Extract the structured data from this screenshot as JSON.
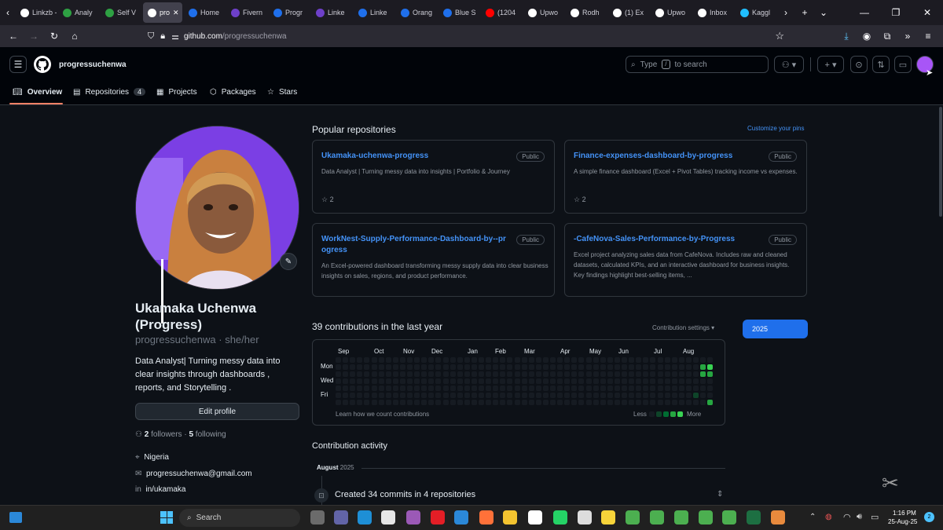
{
  "browser": {
    "tabs": [
      {
        "label": "Linkzb - A",
        "color": "#ffffff"
      },
      {
        "label": "Analy",
        "color": "#2ea043"
      },
      {
        "label": "Self V",
        "color": "#2ea043"
      },
      {
        "label": "pro",
        "color": "#ffffff",
        "active": true
      },
      {
        "label": "Home",
        "color": "#1f6feb"
      },
      {
        "label": "Fivern",
        "color": "#6e40c9"
      },
      {
        "label": "Progr",
        "color": "#1f6feb"
      },
      {
        "label": "Linke",
        "color": "#6e40c9"
      },
      {
        "label": "Linke",
        "color": "#1f6feb"
      },
      {
        "label": "Orang",
        "color": "#1f6feb"
      },
      {
        "label": "Blue S",
        "color": "#1f6feb"
      },
      {
        "label": "(1204",
        "color": "#ff0000"
      },
      {
        "label": "Upwo",
        "color": "#ffffff"
      },
      {
        "label": "Rodh",
        "color": "#ffffff"
      },
      {
        "label": "(1) Ex",
        "color": "#ffffff"
      },
      {
        "label": "Upwo",
        "color": "#ffffff"
      },
      {
        "label": "Inbox",
        "color": "#ffffff"
      },
      {
        "label": "Kaggl",
        "color": "#20beff"
      }
    ],
    "url_host": "github.com",
    "url_path": "/progressuchenwa"
  },
  "github": {
    "username": "progressuchenwa",
    "search_placeholder_pre": "Type",
    "search_key": "/",
    "search_placeholder_post": "to search",
    "nav": {
      "overview": "Overview",
      "repositories": "Repositories",
      "repositories_count": "4",
      "projects": "Projects",
      "packages": "Packages",
      "stars": "Stars"
    }
  },
  "profile": {
    "name_line1": "Ukamaka Uchenwa",
    "name_line2": "(Progress)",
    "login": "progressuchenwa",
    "pronouns": "she/her",
    "bio_lines": [
      "Data Analyst| Turning messy data into",
      "clear insights through dashboards ,",
      "reports, and Storytelling ."
    ],
    "edit_label": "Edit profile",
    "followers_count": "2",
    "followers_label": "followers",
    "following_count": "5",
    "following_label": "following",
    "location": "Nigeria",
    "email": "progressuchenwa@gmail.com",
    "linkedin": "in/ukamaka"
  },
  "popular": {
    "title": "Popular repositories",
    "customize": "Customize your pins",
    "repos": [
      {
        "name": "Ukamaka-uchenwa-progress",
        "badge": "Public",
        "desc": "Data Analyst | Turning messy data into insights | Portfolio & Journey",
        "stars": "2"
      },
      {
        "name": "Finance-expenses-dashboard-by-progress",
        "badge": "Public",
        "desc": "A simple finance dashboard (Excel + Pivot Tables) tracking income vs expenses.",
        "stars": "2"
      },
      {
        "name": "WorkNest-Supply-Performance-Dashboard-by--progress",
        "badge": "Public",
        "desc": "An Excel-powered dashboard transforming messy supply data into clear business insights on sales, regions, and product performance.",
        "stars": ""
      },
      {
        "name": "-CafeNova-Sales-Performance-by-Progress",
        "badge": "Public",
        "desc": "Excel project analyzing sales data from CafeNova. Includes raw and cleaned datasets, calculated KPIs, and an interactive dashboard for business insights. Key findings highlight best-selling items, ...",
        "stars": ""
      }
    ]
  },
  "contributions": {
    "heading": "39 contributions in the last year",
    "settings": "Contribution settings",
    "year": "2025",
    "months": [
      "Sep",
      "Oct",
      "Nov",
      "Dec",
      "Jan",
      "Feb",
      "Mar",
      "Apr",
      "May",
      "Jun",
      "Jul",
      "Aug"
    ],
    "days": [
      "Mon",
      "Wed",
      "Fri"
    ],
    "learn": "Learn how we count contributions",
    "less": "Less",
    "more": "More",
    "colors": {
      "empty": "#161b22",
      "l1": "#0e4429",
      "l2": "#006d32",
      "l3": "#26a641",
      "l4": "#39d353"
    }
  },
  "activity": {
    "title": "Contribution activity",
    "month": "August",
    "year": "2025",
    "item": "Created 34 commits in 4 repositories"
  },
  "taskbar": {
    "search": "Search",
    "time": "1:16 PM",
    "date": "25-Aug-25"
  }
}
